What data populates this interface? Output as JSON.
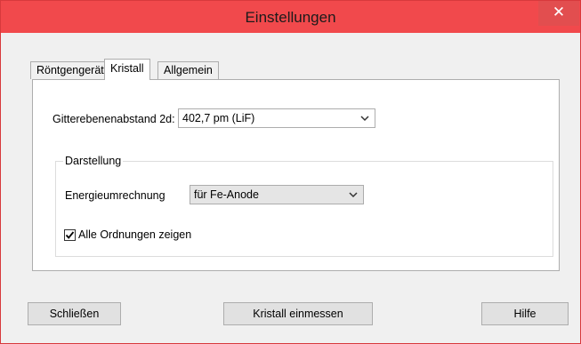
{
  "window": {
    "title": "Einstellungen",
    "close_symbol": "✕"
  },
  "tabs": [
    {
      "label": "Röntgengerät"
    },
    {
      "label": "Kristall",
      "active": true
    },
    {
      "label": "Allgemein"
    }
  ],
  "crystal": {
    "spacing_label": "Gitterebenenabstand 2d:",
    "spacing_value": "402,7 pm (LiF)"
  },
  "display_group": {
    "title": "Darstellung",
    "energy_label": "Energieumrechnung",
    "energy_value": "für Fe-Anode",
    "all_orders_label": "Alle Ordnungen zeigen",
    "all_orders_checked": true
  },
  "buttons": {
    "close": "Schließen",
    "calibrate": "Kristall einmessen",
    "help": "Hilfe"
  },
  "icons": {
    "dropdown": "chevron-down-icon",
    "check": "checkmark-icon"
  },
  "colors": {
    "titlebar": "#f1494c",
    "close_button": "#e24e4f",
    "background": "#f0f0f0"
  }
}
